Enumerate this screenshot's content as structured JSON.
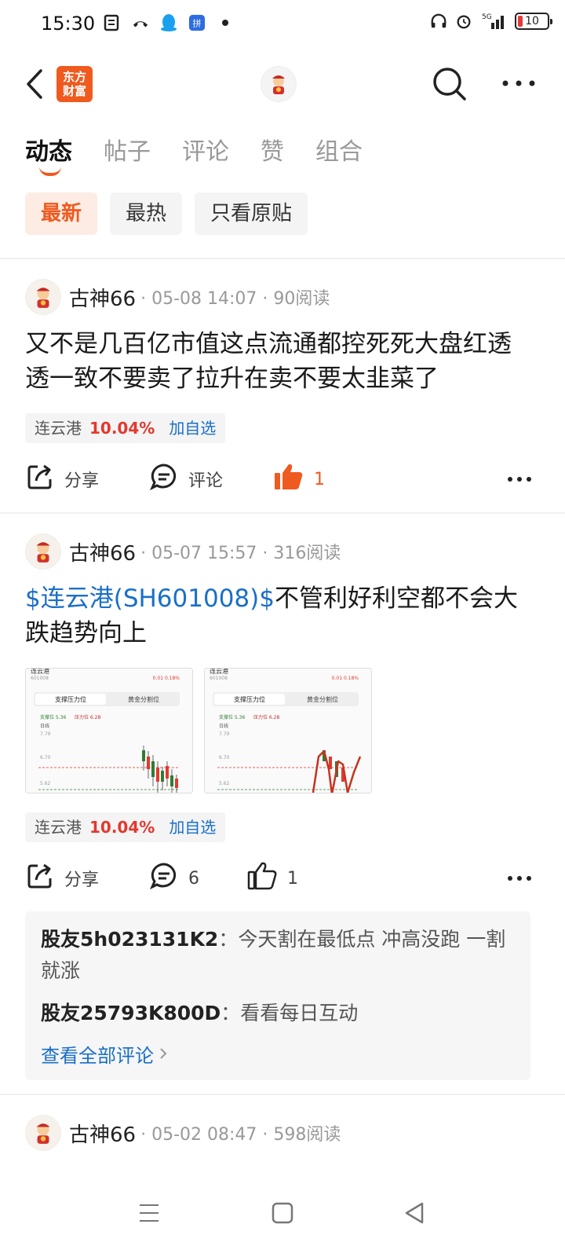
{
  "status_bar": {
    "time": "15:30",
    "network": "5G",
    "battery": "10"
  },
  "header": {
    "app_logo_line1": "东方",
    "app_logo_line2": "财富"
  },
  "tabs": [
    {
      "label": "动态",
      "active": true
    },
    {
      "label": "帖子",
      "active": false
    },
    {
      "label": "评论",
      "active": false
    },
    {
      "label": "赞",
      "active": false
    },
    {
      "label": "组合",
      "active": false
    }
  ],
  "filters": [
    {
      "label": "最新",
      "active": true
    },
    {
      "label": "最热",
      "active": false
    },
    {
      "label": "只看原贴",
      "active": false
    }
  ],
  "posts": [
    {
      "username": "古神66",
      "meta": "· 05-08 14:07 · 90阅读",
      "text": "又不是几百亿市值这点流通都控死死大盘红透透一致不要卖了拉升在卖不要太韭菜了",
      "stock": {
        "name": "连云港",
        "change": "10.04%",
        "add_label": "加自选"
      },
      "share_label": "分享",
      "comment_label": "评论",
      "like_count": "1"
    },
    {
      "username": "古神66",
      "meta": "· 05-07 15:57 · 316阅读",
      "stock_link": "$连云港(SH601008)$",
      "text": "不管利好利空都不会大跌趋势向上",
      "thumbnails": [
        {
          "title": "连云港",
          "code": "601008",
          "change": "0.01 0.18%",
          "tab1": "支撑压力位",
          "tab2": "黄金分割位",
          "support": "支撑位 5.36",
          "pressure": "压力位 6.28",
          "period": "日线",
          "y_top": "7.79",
          "y_mid": "6.70",
          "y_bot": "5.62"
        },
        {
          "title": "连云港",
          "code": "601008",
          "change": "0.01 0.18%",
          "tab1": "支撑压力位",
          "tab2": "黄金分割位",
          "support": "支撑位 5.36",
          "pressure": "压力位 6.28",
          "period": "日线",
          "y_top": "7.79",
          "y_mid": "6.70",
          "y_bot": "5.62"
        }
      ],
      "stock": {
        "name": "连云港",
        "change": "10.04%",
        "add_label": "加自选"
      },
      "share_label": "分享",
      "comment_count": "6",
      "like_count": "1",
      "comments": [
        {
          "who": "股友5h023131K2",
          "text": "：今天割在最低点 冲高没跑 一割就涨"
        },
        {
          "who": "股友25793K800D",
          "text": "：看看每日互动"
        }
      ],
      "view_all": "查看全部评论"
    },
    {
      "username": "古神66",
      "meta": "· 05-02 08:47 · 598阅读"
    }
  ],
  "colors": {
    "accent": "#ef5a1f",
    "link": "#1a6fc8",
    "rise": "#e2382f"
  }
}
